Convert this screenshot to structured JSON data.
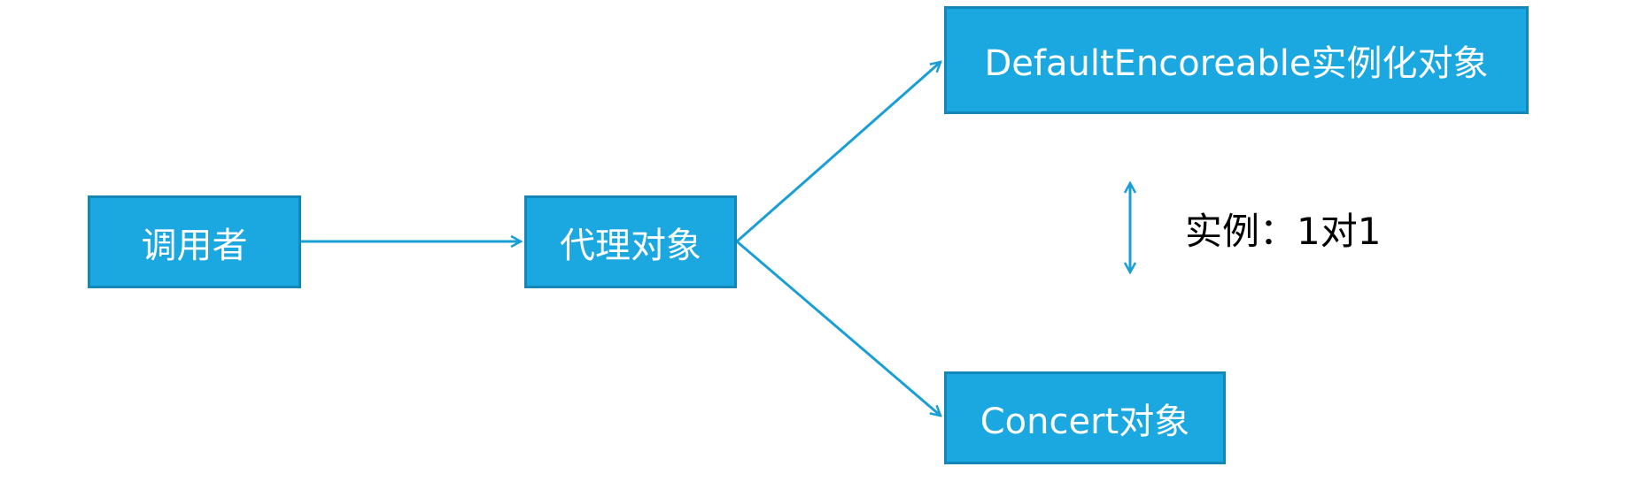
{
  "nodes": {
    "caller": "调用者",
    "proxy": "代理对象",
    "default_instance": "DefaultEncoreable实例化对象",
    "concert": "Concert对象"
  },
  "note": "实例：1对1",
  "colors": {
    "node_fill": "#1ba8e0",
    "node_border": "#1487b9",
    "arrow": "#1a9fd4",
    "text": "#ffffff"
  }
}
